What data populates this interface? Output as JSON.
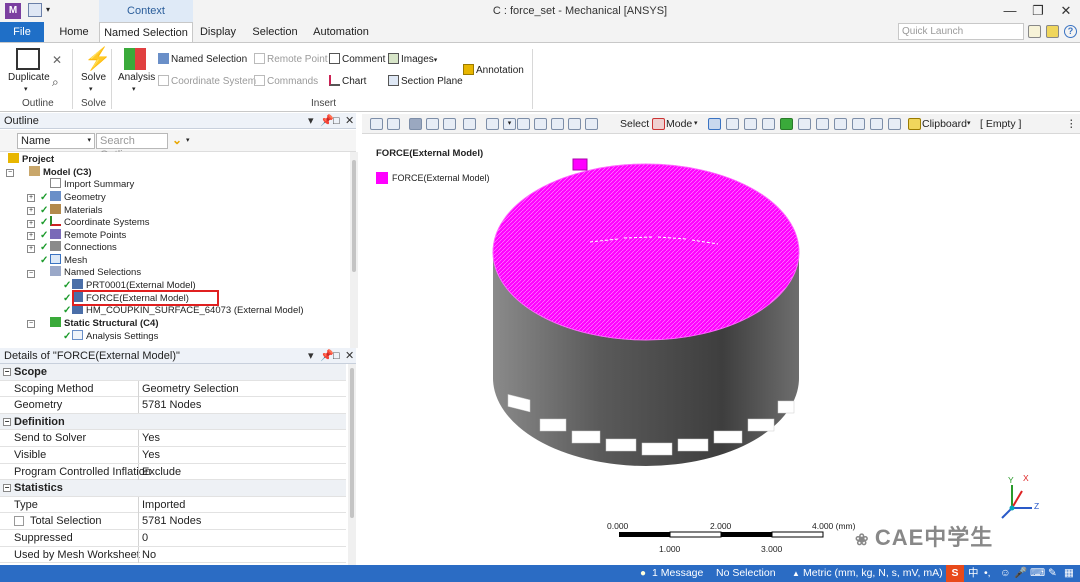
{
  "window": {
    "title": "C : force_set - Mechanical [ANSYS]",
    "context_label": "Context",
    "app_icon": "M",
    "minimize": "—",
    "restore": "❐",
    "close": "✕"
  },
  "tabs": [
    "File",
    "Home",
    "Named Selection",
    "Display",
    "Selection",
    "Automation"
  ],
  "quick_launch_placeholder": "Quick Launch",
  "ribbon": {
    "duplicate": "Duplicate",
    "solve": "Solve",
    "analysis": "Analysis",
    "named_selection": "Named Selection",
    "remote_point": "Remote Point",
    "comment": "Comment",
    "images": "Images",
    "coordinate_system": "Coordinate System",
    "commands": "Commands",
    "chart": "Chart",
    "section_plane": "Section Plane",
    "annotation": "Annotation",
    "groups": [
      "Outline",
      "Solve",
      "Insert"
    ]
  },
  "outline": {
    "title": "Outline",
    "name_filter": "Name",
    "search_placeholder": "Search Outline",
    "tree": [
      {
        "label": "Project",
        "level": 0,
        "bold": true
      },
      {
        "label": "Model (C3)",
        "level": 1,
        "bold": true
      },
      {
        "label": "Import Summary",
        "level": 2
      },
      {
        "label": "Geometry",
        "level": 2
      },
      {
        "label": "Materials",
        "level": 2
      },
      {
        "label": "Coordinate Systems",
        "level": 2
      },
      {
        "label": "Remote Points",
        "level": 2
      },
      {
        "label": "Connections",
        "level": 2
      },
      {
        "label": "Mesh",
        "level": 2
      },
      {
        "label": "Named Selections",
        "level": 2
      },
      {
        "label": "PRT0001(External Model)",
        "level": 3
      },
      {
        "label": "FORCE(External Model)",
        "level": 3,
        "selected": true
      },
      {
        "label": "HM_COUPKIN_SURFACE_64073 (External Model)",
        "level": 3
      },
      {
        "label": "Static Structural (C4)",
        "level": 1,
        "bold": true
      },
      {
        "label": "Analysis Settings",
        "level": 2
      }
    ]
  },
  "details": {
    "title": "Details of \"FORCE(External Model)\"",
    "rows": [
      {
        "type": "section",
        "label": "Scope"
      },
      {
        "label": "Scoping Method",
        "value": "Geometry Selection"
      },
      {
        "label": "Geometry",
        "value": "5781 Nodes"
      },
      {
        "type": "section",
        "label": "Definition"
      },
      {
        "label": "Send to Solver",
        "value": "Yes"
      },
      {
        "label": "Visible",
        "value": "Yes"
      },
      {
        "label": "Program Controlled Inflation",
        "value": "Exclude"
      },
      {
        "type": "section",
        "label": "Statistics"
      },
      {
        "label": "Type",
        "value": "Imported"
      },
      {
        "label": "Total Selection",
        "value": "5781 Nodes",
        "checkbox": true
      },
      {
        "label": "Suppressed",
        "value": "0"
      },
      {
        "label": "Used by Mesh Worksheet",
        "value": "No"
      }
    ]
  },
  "graphics_toolbar": {
    "select": "Select",
    "mode": "Mode",
    "clipboard": "Clipboard",
    "empty": "[ Empty ]"
  },
  "viewport": {
    "title": "FORCE(External Model)",
    "legend": "FORCE(External Model)",
    "scale_top": [
      "0.000",
      "2.000",
      "4.000 (mm)"
    ],
    "scale_bottom": [
      "1.000",
      "3.000"
    ],
    "axis_x": "X",
    "axis_y": "Y",
    "axis_z": "Z",
    "watermark": "CAE中学生"
  },
  "colors": {
    "accent": "#2b6cc4",
    "highlight": "#ff00ff",
    "body": "#5a5a5a"
  },
  "status": {
    "messages": "1 Message",
    "selection": "No Selection",
    "units": "Metric (mm, kg, N, s, mV, mA)"
  }
}
